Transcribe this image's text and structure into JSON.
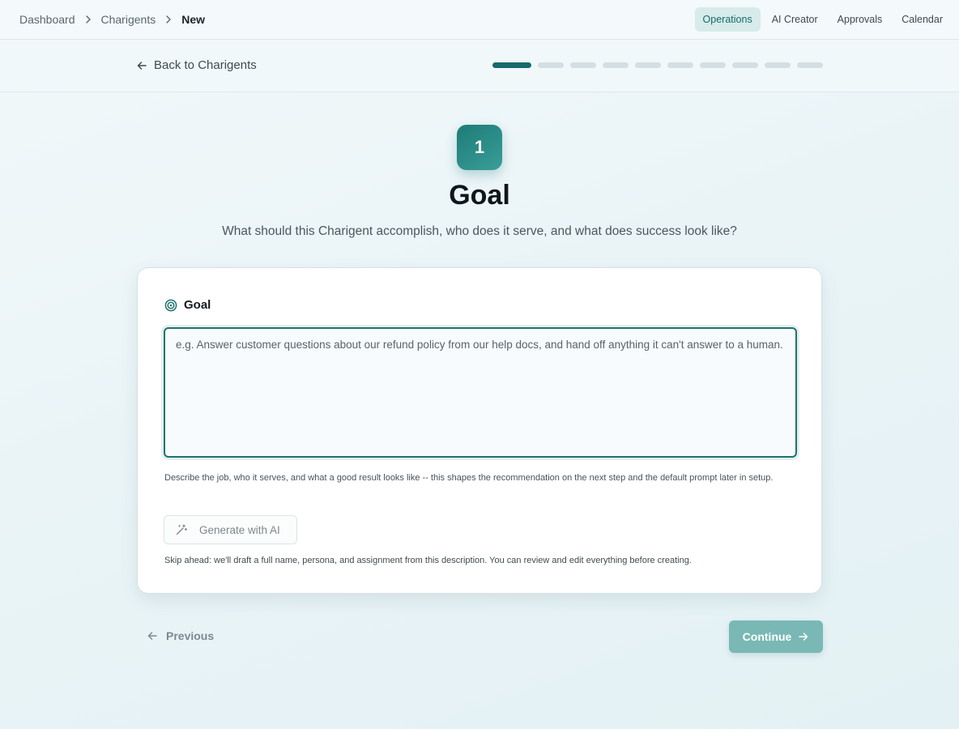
{
  "breadcrumb": {
    "items": [
      "Dashboard",
      "Charigents",
      "New"
    ]
  },
  "nav": {
    "items": [
      {
        "label": "Operations",
        "active": true
      },
      {
        "label": "AI Creator",
        "active": false
      },
      {
        "label": "Approvals",
        "active": false
      },
      {
        "label": "Calendar",
        "active": false
      }
    ]
  },
  "subheader": {
    "back_label": "Back to Charigents",
    "progress": {
      "current_step": 1,
      "total_steps": 10
    }
  },
  "step": {
    "number": "1",
    "title": "Goal",
    "subtitle": "What should this Charigent accomplish, who does it serve, and what does success look like?"
  },
  "form": {
    "goal_label": "Goal",
    "goal_value": "",
    "goal_placeholder": "e.g. Answer customer questions about our refund policy from our help docs, and hand off anything it can't answer to a human.",
    "helper_text": "Describe the job, who it serves, and what a good result looks like -- this shapes the recommendation on the next step and the default prompt later in setup.",
    "generate_label": "Generate with AI",
    "skip_text": "Skip ahead: we'll draft a full name, persona, and assignment from this description. You can review and edit everything before creating."
  },
  "footer": {
    "previous_label": "Previous",
    "continue_label": "Continue"
  },
  "colors": {
    "accent": "#17696a",
    "continue_disabled": "#79b8b5"
  },
  "icons": [
    "arrow-left-icon",
    "chevron-right-icon",
    "target-icon",
    "magic-wand-icon",
    "arrow-right-icon"
  ]
}
